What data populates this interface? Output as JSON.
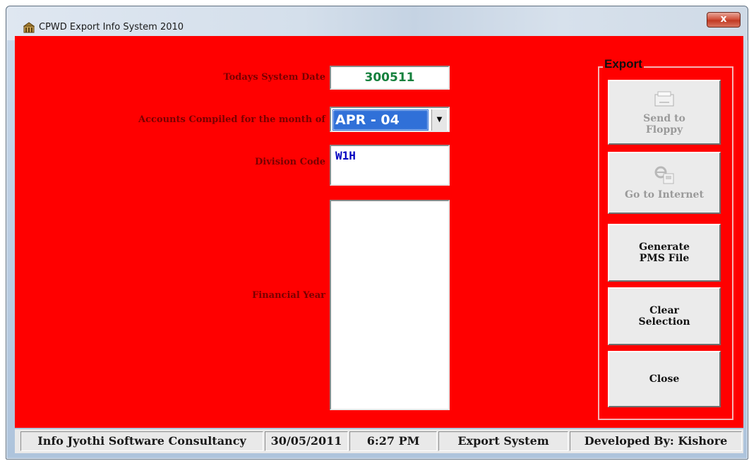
{
  "window": {
    "title": "CPWD Export Info System 2010",
    "close_label": "x",
    "accent": "#ff0000"
  },
  "form": {
    "system_date_label": "Todays System Date",
    "system_date_value": "300511",
    "month_label": "Accounts Compiled for the month of",
    "month_value": "APR - 04",
    "division_label": "Division Code",
    "division_value": "W1H",
    "financial_year_label": "Financial Year"
  },
  "export": {
    "title": "Export",
    "buttons": [
      {
        "label": "Send to Floppy",
        "icon": "floppy-drive-icon",
        "enabled": false
      },
      {
        "label": "Go to Internet",
        "icon": "internet-explorer-icon",
        "enabled": false
      },
      {
        "label": "Generate PMS File",
        "enabled": true
      },
      {
        "label": "Clear Selection",
        "enabled": true
      },
      {
        "label": "Close",
        "enabled": true
      }
    ]
  },
  "statusbar": {
    "company": "Info Jyothi Software Consultancy",
    "date": "30/05/2011",
    "time": "6:27 PM",
    "system": "Export System",
    "developer": "Developed By: Kishore"
  }
}
